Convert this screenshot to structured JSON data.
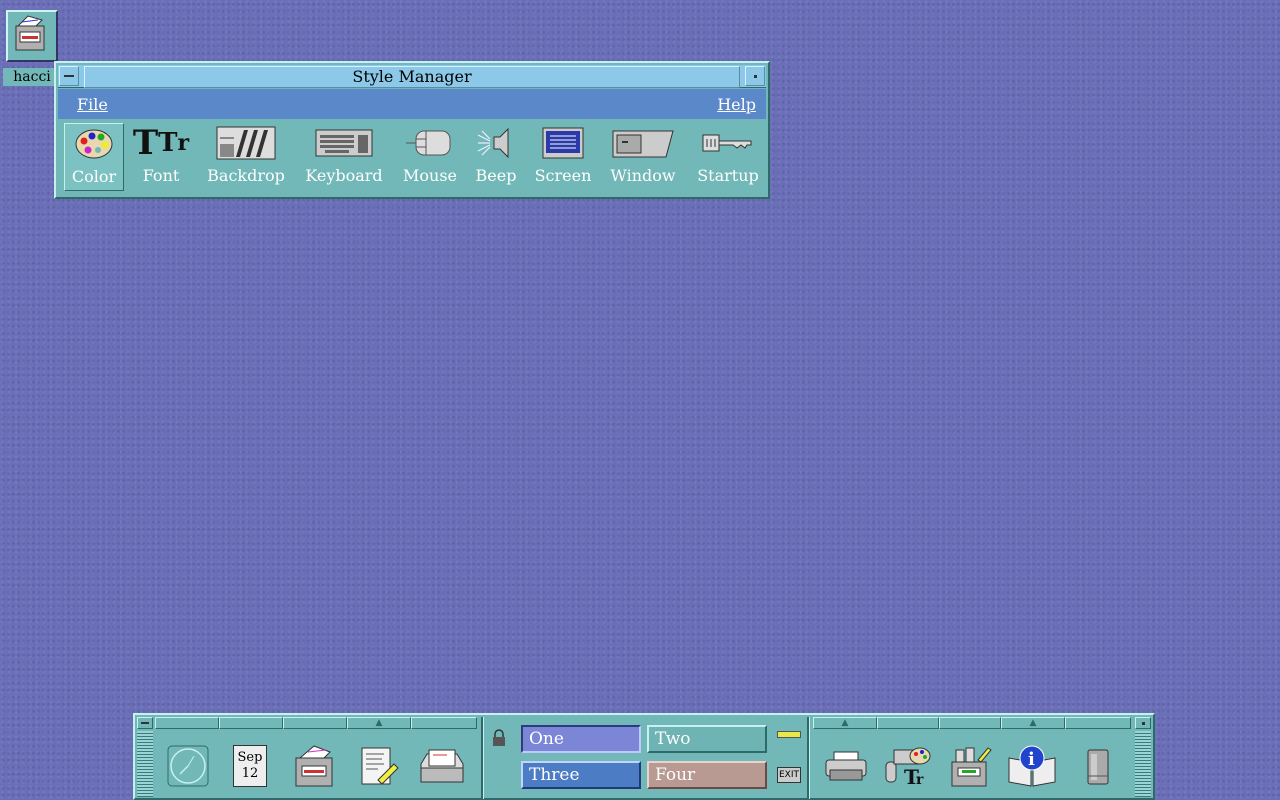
{
  "desktop": {
    "icon_label": "hacci"
  },
  "style_manager": {
    "title": "Style Manager",
    "menus": {
      "file": "File",
      "help": "Help"
    },
    "tools": [
      "Color",
      "Font",
      "Backdrop",
      "Keyboard",
      "Mouse",
      "Beep",
      "Screen",
      "Window",
      "Startup"
    ],
    "selected_tool": "Color"
  },
  "front_panel": {
    "calendar": {
      "month": "Sep",
      "day": "12"
    },
    "workspaces": [
      "One",
      "Two",
      "Three",
      "Four"
    ],
    "active_workspace": "One",
    "exit_label": "EXIT",
    "colors": {
      "one": "#7b86d6",
      "two": "#6fb4b4",
      "three": "#4c7cc4",
      "four": "#b89a92"
    }
  },
  "icons": {
    "panel_left": [
      "clock-icon",
      "calendar-icon",
      "file-manager-icon",
      "text-editor-icon",
      "mailer-icon"
    ],
    "panel_right": [
      "printer-icon",
      "style-manager-icon",
      "application-manager-icon",
      "help-icon",
      "trash-icon"
    ]
  }
}
